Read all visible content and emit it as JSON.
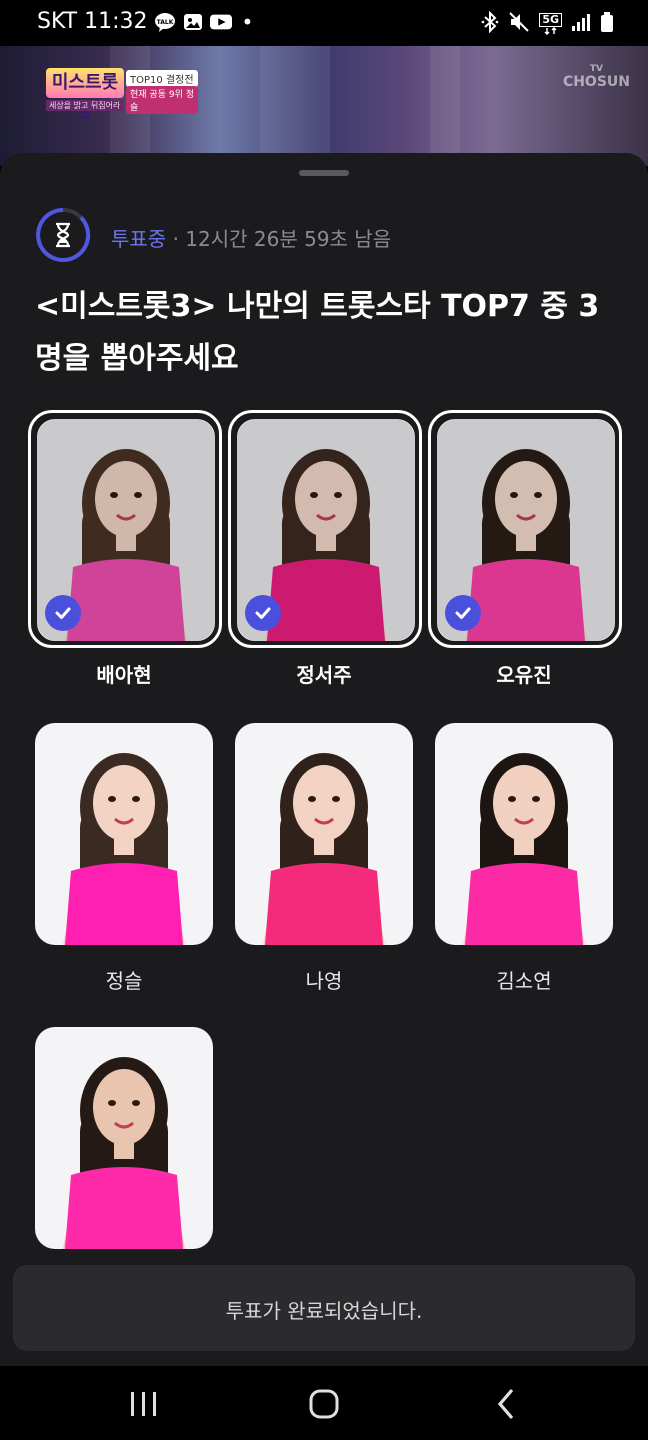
{
  "status_bar": {
    "carrier_time": "SKT 11:32",
    "talk_icon_label": "TALK",
    "dot": "•",
    "network_label": "5G",
    "icons": [
      "talk-icon",
      "gallery-icon",
      "youtube-icon",
      "bluetooth-icon",
      "mute-icon",
      "signal-icon",
      "battery-icon"
    ]
  },
  "video": {
    "show_logo": "미스트롯3",
    "logo_sub": "TOP10 결정전",
    "logo_sub2": "현재 공동 9위 정슬",
    "logo_tag": "세상을 밝고 뒤집어라",
    "broadcaster_small": "TV",
    "broadcaster_main": "CHOSUN"
  },
  "vote": {
    "status": "투표중",
    "separator": "·",
    "remaining": "12시간 26분 59초 남음",
    "title": "<미스트롯3> 나만의 트롯스타 TOP7 중 3명을 뽑아주세요"
  },
  "candidates": [
    {
      "name": "배아현",
      "selected": true,
      "colors": {
        "bg": "#ececef",
        "dress": "#f24fb2",
        "hair": "#4a3325",
        "skin": "#f3d6c5"
      }
    },
    {
      "name": "정서주",
      "selected": true,
      "colors": {
        "bg": "#ececef",
        "dress": "#ee1f83",
        "hair": "#3d2a20",
        "skin": "#f5dacb"
      }
    },
    {
      "name": "오유진",
      "selected": true,
      "colors": {
        "bg": "#ececef",
        "dress": "#ff3fa8",
        "hair": "#2c1e18",
        "skin": "#f6dccd"
      }
    },
    {
      "name": "정슬",
      "selected": false,
      "colors": {
        "bg": "#f4f4f6",
        "dress": "#ff1fb0",
        "hair": "#3a2a22",
        "skin": "#f3d4c4"
      }
    },
    {
      "name": "나영",
      "selected": false,
      "colors": {
        "bg": "#f4f4f6",
        "dress": "#f42b7a",
        "hair": "#30221b",
        "skin": "#f2d3c3"
      }
    },
    {
      "name": "김소연",
      "selected": false,
      "colors": {
        "bg": "#f4f4f6",
        "dress": "#fd2aa5",
        "hair": "#1d1512",
        "skin": "#f1d0c0"
      }
    },
    {
      "name": "",
      "selected": false,
      "colors": {
        "bg": "#f4f4f6",
        "dress": "#ff2aa9",
        "hair": "#241915",
        "skin": "#e9c4ae"
      }
    }
  ],
  "toast": {
    "message": "투표가 완료되었습니다."
  },
  "navbar": {
    "icons": [
      "recent-apps-icon",
      "home-icon",
      "back-icon"
    ]
  },
  "colors": {
    "accent": "#4a4fdc",
    "voting_text": "#6d74ee",
    "sheet_bg": "#1b1b1d"
  }
}
